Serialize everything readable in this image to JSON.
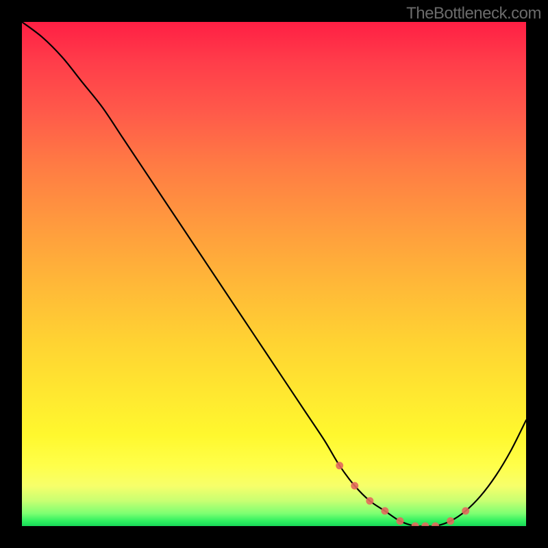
{
  "watermark": "TheBottleneck.com",
  "chart_data": {
    "type": "line",
    "title": "",
    "xlabel": "",
    "ylabel": "",
    "xlim": [
      0,
      100
    ],
    "ylim": [
      0,
      100
    ],
    "series": [
      {
        "name": "bottleneck-curve",
        "x": [
          0,
          4,
          8,
          12,
          16,
          20,
          24,
          28,
          32,
          36,
          40,
          44,
          48,
          52,
          56,
          60,
          63,
          66,
          69,
          72,
          75,
          78,
          80,
          82,
          85,
          88,
          91,
          94,
          97,
          100
        ],
        "y": [
          100,
          97,
          93,
          88,
          83,
          77,
          71,
          65,
          59,
          53,
          47,
          41,
          35,
          29,
          23,
          17,
          12,
          8,
          5,
          3,
          1,
          0,
          0,
          0,
          1,
          3,
          6,
          10,
          15,
          21
        ]
      }
    ],
    "markers": {
      "name": "optimal-range",
      "x": [
        63,
        66,
        69,
        72,
        75,
        78,
        80,
        82,
        85,
        88
      ],
      "y": [
        12,
        8,
        5,
        3,
        1,
        0,
        0,
        0,
        1,
        3
      ]
    },
    "gradient_stops": [
      {
        "pos": 0.0,
        "color": "#ff1f44"
      },
      {
        "pos": 0.5,
        "color": "#ffb838"
      },
      {
        "pos": 0.85,
        "color": "#ffff4a"
      },
      {
        "pos": 1.0,
        "color": "#18d858"
      }
    ]
  }
}
